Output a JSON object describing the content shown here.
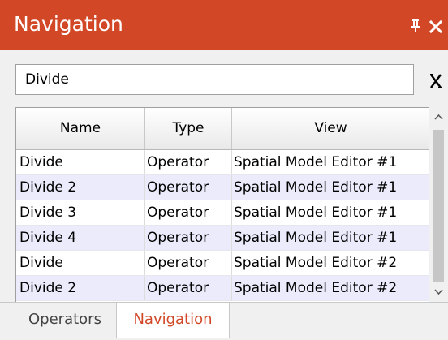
{
  "panel": {
    "title": "Navigation",
    "accent_color": "#d24726",
    "icons": {
      "pin": "pin-icon",
      "close": "close-icon",
      "clear": "clear-x-icon"
    }
  },
  "search": {
    "value": "Divide"
  },
  "table": {
    "columns": [
      "Name",
      "Type",
      "View"
    ],
    "rows": [
      {
        "name": "Divide",
        "type": "Operator",
        "view": "Spatial Model Editor #1"
      },
      {
        "name": "Divide 2",
        "type": "Operator",
        "view": "Spatial Model Editor #1"
      },
      {
        "name": "Divide 3",
        "type": "Operator",
        "view": "Spatial Model Editor #1"
      },
      {
        "name": "Divide 4",
        "type": "Operator",
        "view": "Spatial Model Editor #1"
      },
      {
        "name": "Divide",
        "type": "Operator",
        "view": "Spatial Model Editor #2"
      },
      {
        "name": "Divide 2",
        "type": "Operator",
        "view": "Spatial Model Editor #2"
      }
    ]
  },
  "tabs": [
    {
      "label": "Operators",
      "active": false
    },
    {
      "label": "Navigation",
      "active": true
    }
  ]
}
